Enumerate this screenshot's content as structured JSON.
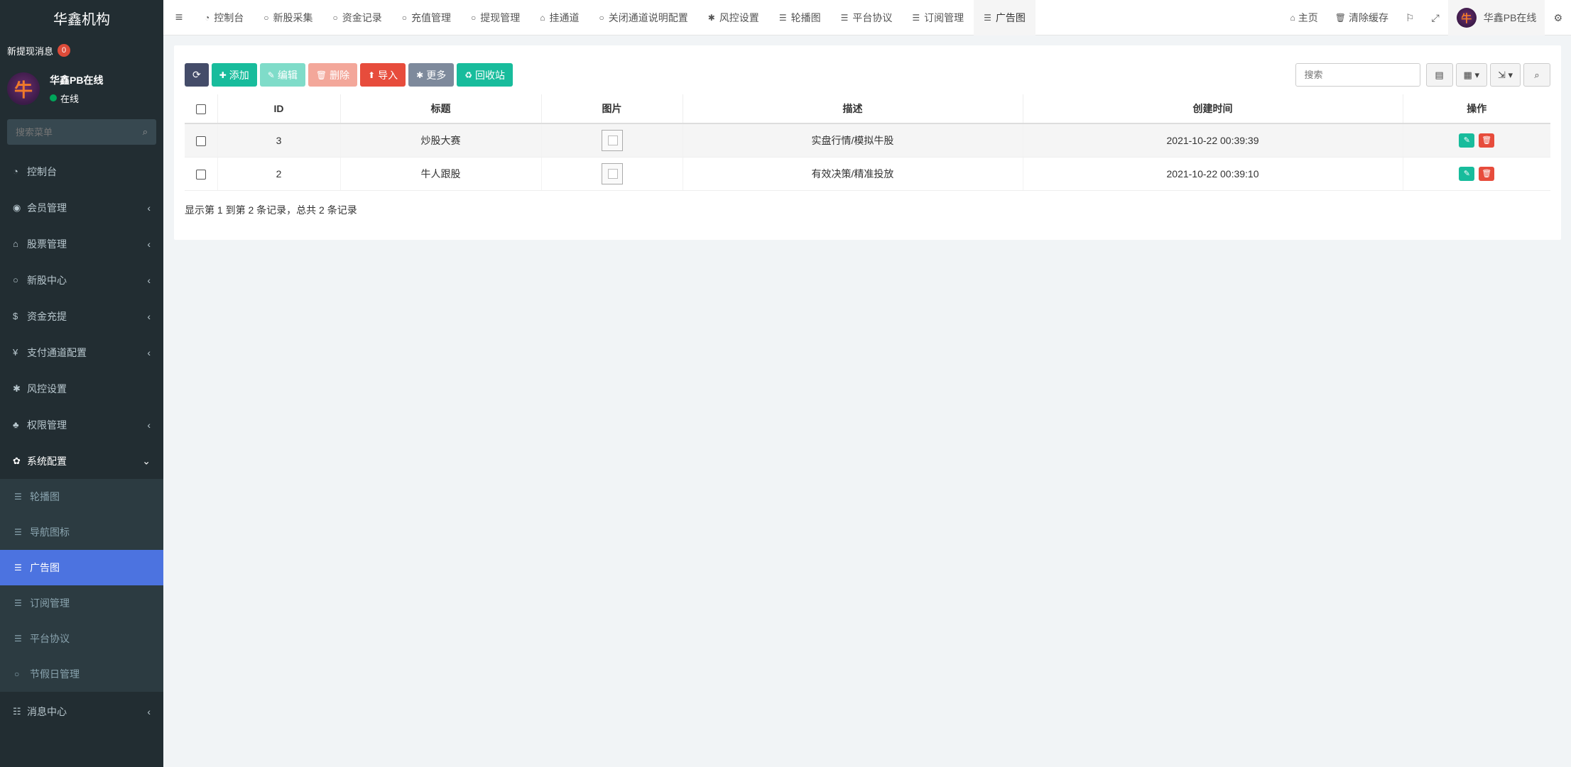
{
  "sidebar": {
    "logo": "华鑫机构",
    "notice_text": "新提现消息",
    "notice_count": "0",
    "user": {
      "name": "华鑫PB在线",
      "status": "在线",
      "avatar_char": "牛"
    },
    "search_placeholder": "搜索菜单",
    "menu": [
      {
        "label": "控制台",
        "icon": "dashboard-icon",
        "glyph": "◔"
      },
      {
        "label": "会员管理",
        "icon": "user-circle-icon",
        "glyph": "◉",
        "caret": "‹"
      },
      {
        "label": "股票管理",
        "icon": "bank-icon",
        "glyph": "⌂",
        "caret": "‹"
      },
      {
        "label": "新股中心",
        "icon": "circle-icon",
        "glyph": "○",
        "caret": "‹"
      },
      {
        "label": "资金充提",
        "icon": "dollar-icon",
        "glyph": "$",
        "caret": "‹"
      },
      {
        "label": "支付通道配置",
        "icon": "yen-icon",
        "glyph": "¥",
        "caret": "‹"
      },
      {
        "label": "风控设置",
        "icon": "gear-icon",
        "glyph": "✱"
      },
      {
        "label": "权限管理",
        "icon": "group-icon",
        "glyph": "♣",
        "caret": "‹"
      }
    ],
    "system_menu": {
      "label": "系统配置",
      "icon": "gear-icon",
      "glyph": "✿",
      "caret": "⌄"
    },
    "sub_menu": [
      {
        "label": "轮播图",
        "icon": "list-icon",
        "glyph": "☰"
      },
      {
        "label": "导航图标",
        "icon": "list-icon",
        "glyph": "☰"
      },
      {
        "label": "广告图",
        "icon": "list-icon",
        "glyph": "☰"
      },
      {
        "label": "订阅管理",
        "icon": "list-icon",
        "glyph": "☰"
      },
      {
        "label": "平台协议",
        "icon": "list-icon",
        "glyph": "☰"
      },
      {
        "label": "节假日管理",
        "icon": "circle-icon",
        "glyph": "○"
      }
    ],
    "message_menu": {
      "label": "消息中心",
      "icon": "list-icon",
      "glyph": "☷",
      "caret": "‹"
    }
  },
  "topbar": {
    "tabs": [
      {
        "label": "控制台",
        "glyph": "◔",
        "icon": "dashboard-icon"
      },
      {
        "label": "新股采集",
        "glyph": "○",
        "icon": "circle-icon"
      },
      {
        "label": "资金记录",
        "glyph": "○",
        "icon": "circle-icon"
      },
      {
        "label": "充值管理",
        "glyph": "○",
        "icon": "circle-icon"
      },
      {
        "label": "提现管理",
        "glyph": "○",
        "icon": "circle-icon"
      },
      {
        "label": "挂通道",
        "glyph": "⌂",
        "icon": "bank-icon"
      },
      {
        "label": "关闭通道说明配置",
        "glyph": "○",
        "icon": "circle-icon"
      },
      {
        "label": "风控设置",
        "glyph": "✱",
        "icon": "gear-icon"
      },
      {
        "label": "轮播图",
        "glyph": "☰",
        "icon": "list-icon"
      },
      {
        "label": "平台协议",
        "glyph": "☰",
        "icon": "list-icon"
      },
      {
        "label": "订阅管理",
        "glyph": "☰",
        "icon": "list-icon"
      },
      {
        "label": "广告图",
        "glyph": "☰",
        "icon": "list-icon"
      }
    ],
    "home_label": "主页",
    "clear_cache_label": "清除缓存",
    "user_name": "华鑫PB在线"
  },
  "toolbar": {
    "refresh_glyph": "⟳",
    "add_label": "添加",
    "edit_label": "编辑",
    "delete_label": "删除",
    "import_label": "导入",
    "more_label": "更多",
    "recycle_label": "回收站",
    "search_placeholder": "搜索"
  },
  "table": {
    "columns": [
      "ID",
      "标题",
      "图片",
      "描述",
      "创建时间",
      "操作"
    ],
    "rows": [
      {
        "id": "3",
        "title": "炒股大赛",
        "description": "实盘行情/模拟牛股",
        "created": "2021-10-22 00:39:39"
      },
      {
        "id": "2",
        "title": "牛人跟股",
        "description": "有效决策/精准投放",
        "created": "2021-10-22 00:39:10"
      }
    ]
  },
  "pagination": {
    "summary": "显示第 1 到第 2 条记录，总共 2 条记录"
  },
  "colors": {
    "sidebar_bg": "#222d32",
    "active_item": "#4c73e0",
    "primary_green": "#18bc9c",
    "danger_red": "#e74c3c"
  }
}
